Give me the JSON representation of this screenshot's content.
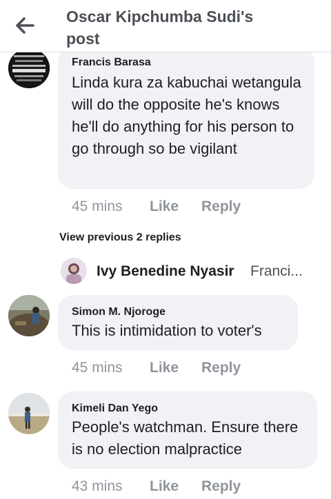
{
  "header": {
    "title": "Oscar Kipchumba Sudi's post",
    "back_icon": "arrow-left-icon"
  },
  "comments": [
    {
      "author": "Francis Barasa",
      "text": "Linda kura za kabuchai wetangula will do the opposite he's knows he'll do anything for his person to go through so be vigilant",
      "time": "45 mins",
      "like_label": "Like",
      "reply_label": "Reply"
    },
    {
      "author": "Simon M. Njoroge",
      "text": "This is intimidation to voter's",
      "time": "45 mins",
      "like_label": "Like",
      "reply_label": "Reply"
    },
    {
      "author": "Kimeli Dan Yego",
      "text": "People's watchman. Ensure there is no election malpractice",
      "time": "43 mins",
      "like_label": "Like",
      "reply_label": "Reply"
    }
  ],
  "replies": {
    "view_previous_label": "View previous 2 replies",
    "latest": {
      "author": "Ivy Benedine Nyasir",
      "preview": "Franci..."
    }
  },
  "colors": {
    "bubble": "#f0f2f5",
    "meta_text": "#90949c",
    "title_text": "#4b4f56"
  }
}
